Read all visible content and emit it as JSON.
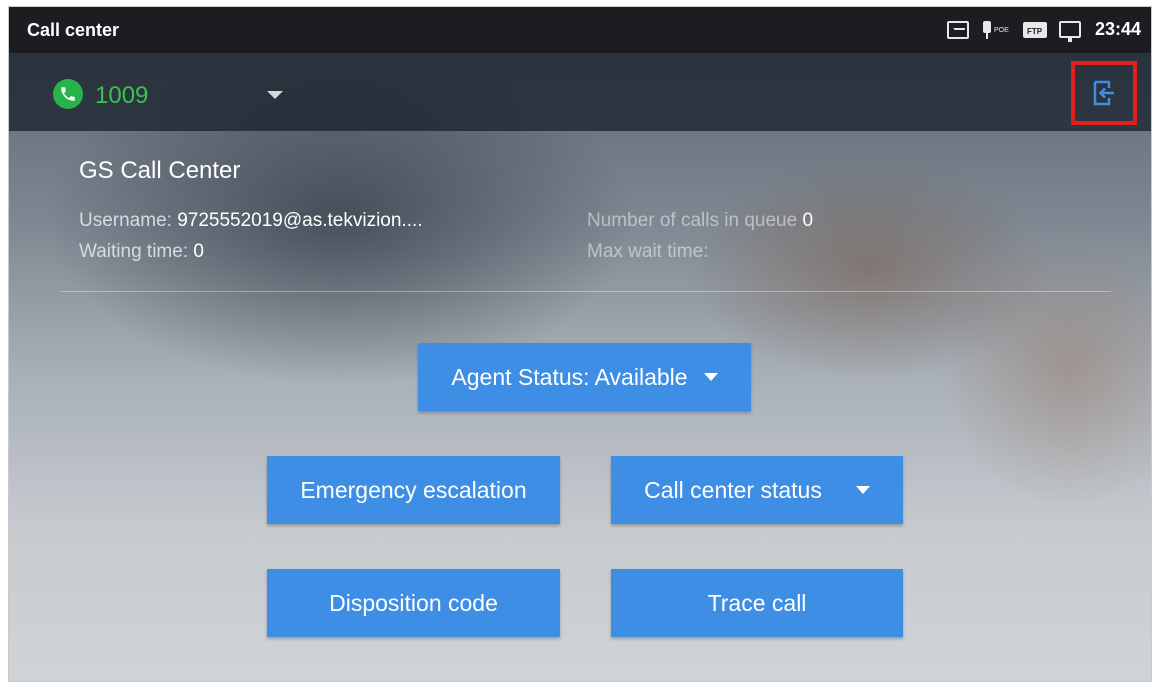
{
  "statusbar": {
    "title": "Call center",
    "poe_label": "POE",
    "ftp_label": "FTP",
    "time": "23:44"
  },
  "account": {
    "number": "1009",
    "accent_color": "#27b24a"
  },
  "center": {
    "name": "GS Call Center",
    "username_label": "Username: ",
    "username_value": "9725552019@as.tekvizion....",
    "waiting_label": "Waiting time: ",
    "waiting_value": "0",
    "queue_label": "Number of calls in queue ",
    "queue_value": "0",
    "max_wait_label": "Max wait time:",
    "max_wait_value": ""
  },
  "buttons": {
    "agent_status": "Agent Status: Available",
    "emergency": "Emergency escalation",
    "call_center_status": "Call center status",
    "disposition": "Disposition code",
    "trace": "Trace call",
    "color": "#3d8ee4"
  },
  "icons": {
    "phone": "phone-icon",
    "logout": "logout-icon",
    "screenshot": "image-icon",
    "poe": "poe-icon",
    "ftp": "ftp-icon",
    "network": "network-icon"
  },
  "highlight_color": "#e02020"
}
